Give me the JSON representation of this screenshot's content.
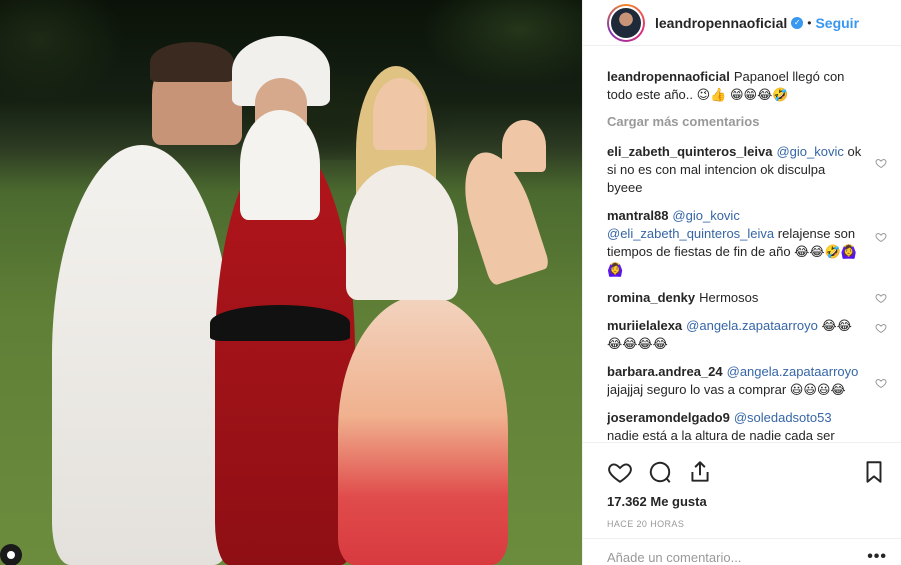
{
  "post": {
    "username": "leandropennaoficial",
    "follow_label": "Seguir",
    "dot": "•",
    "verified_glyph": "✓"
  },
  "caption": {
    "user": "leandropennaoficial",
    "text": "Papanoel llegó con todo este año.. 😉👍 😁😁😂🤣"
  },
  "load_more": "Cargar más comentarios",
  "comments": [
    {
      "user": "eli_zabeth_quinteros_leiva",
      "mention": "@gio_kovic",
      "text": "ok si no es con mal intencion ok disculpa byeee"
    },
    {
      "user": "mantral88",
      "mention": "@gio_kovic @eli_zabeth_quinteros_leiva",
      "text": "relajense son tiempos de fiestas de fin de año 😂😂🤣🙆‍♀️🙆‍♀️"
    },
    {
      "user": "romina_denky",
      "mention": "",
      "text": "Hermosos"
    },
    {
      "user": "muriielalexa",
      "mention": "@angela.zapataarroyo",
      "text": "😂😂😂😂😂😂"
    },
    {
      "user": "barbara.andrea_24",
      "mention": "@angela.zapataarroyo",
      "text": "jajajjaj seguro lo vas a comprar 😃😃😃😂"
    },
    {
      "user": "joseramondelgado9",
      "mention": "@soledadsoto53",
      "text": "nadie está a la altura de nadie cada ser"
    }
  ],
  "likes": "17.362 Me gusta",
  "time": "HACE 20 HORAS",
  "add_comment_placeholder": "Añade un comentario...",
  "more_options": "•••",
  "icons": {
    "like": "heart-icon",
    "comment": "comment-bubble-icon",
    "share": "share-icon",
    "save": "bookmark-icon",
    "tag": "user-tag-icon"
  }
}
